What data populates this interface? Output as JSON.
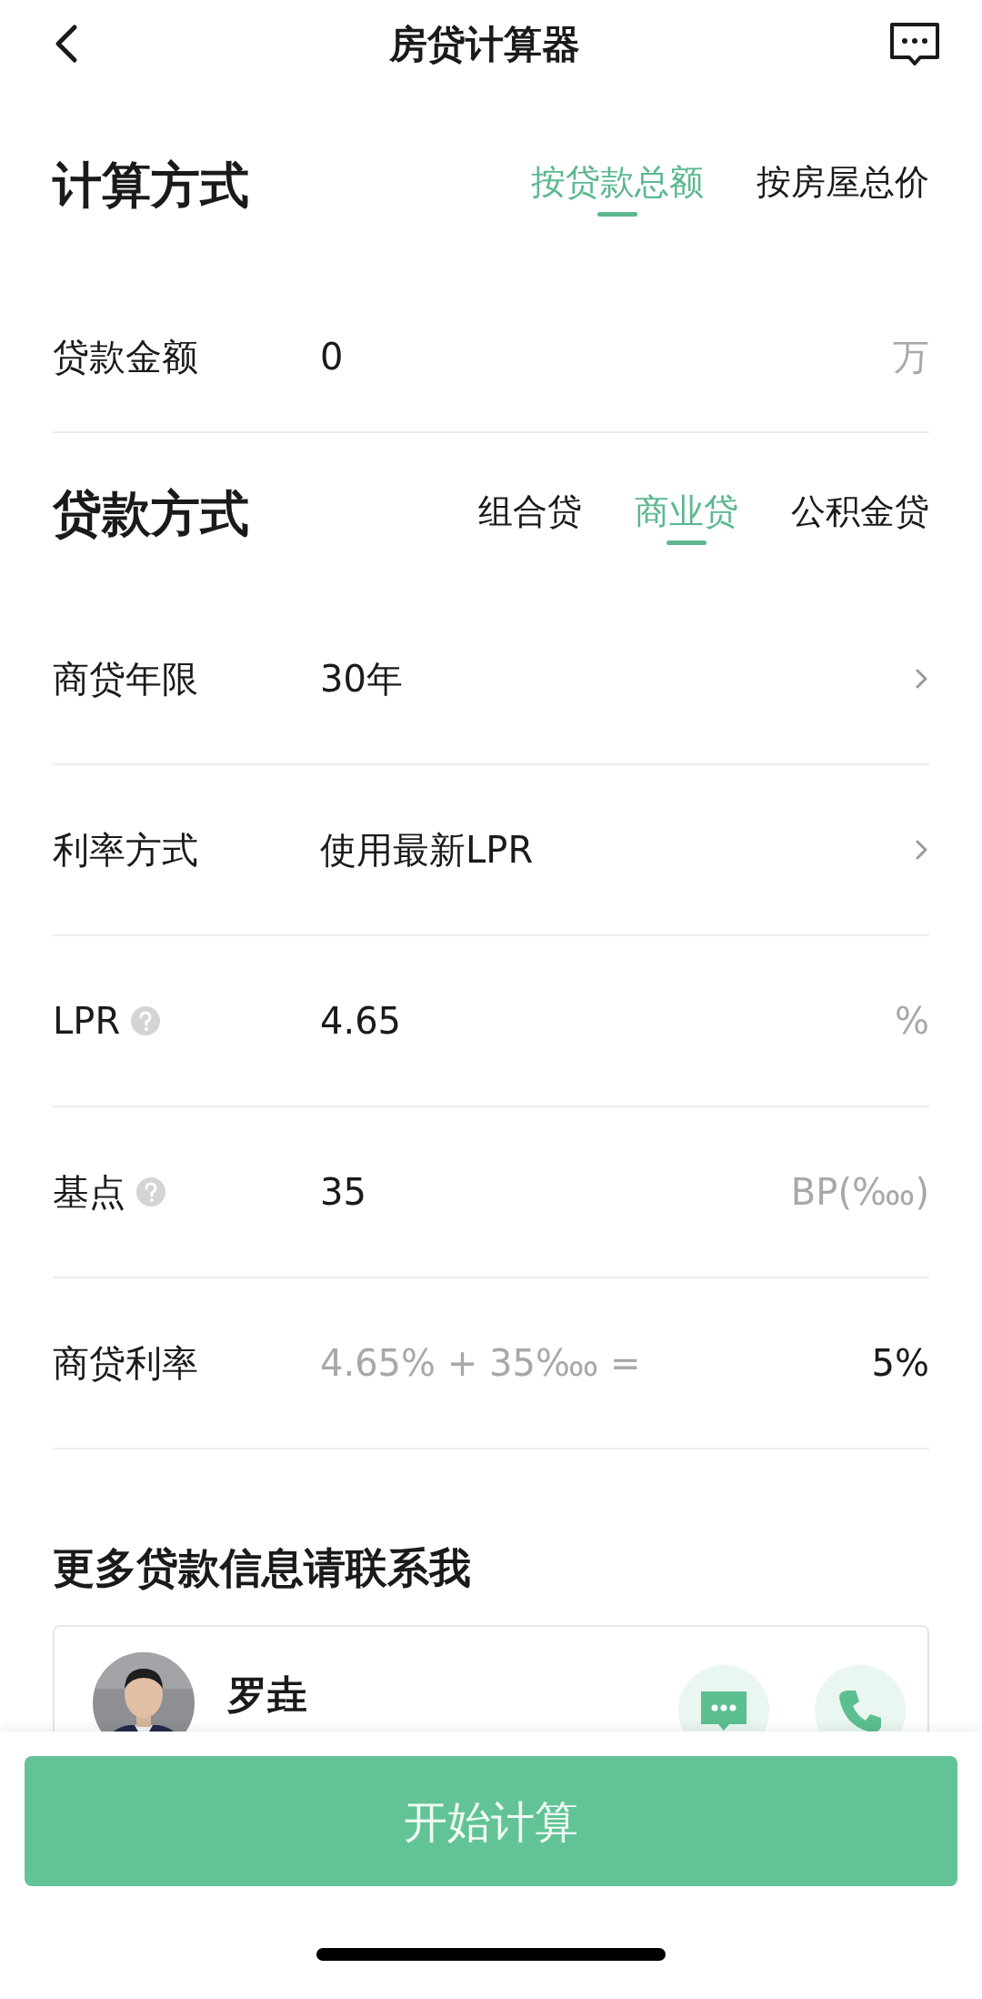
{
  "header": {
    "title": "房贷计算器"
  },
  "calc_method": {
    "title": "计算方式",
    "tabs": [
      {
        "label": "按贷款总额",
        "selected": true
      },
      {
        "label": "按房屋总价",
        "selected": false
      }
    ]
  },
  "loan_amount": {
    "label": "贷款金额",
    "value": "0",
    "unit": "万"
  },
  "loan_type": {
    "title": "贷款方式",
    "tabs": [
      {
        "label": "组合贷",
        "selected": false
      },
      {
        "label": "商业贷",
        "selected": true
      },
      {
        "label": "公积金贷",
        "selected": false
      }
    ]
  },
  "rows": [
    {
      "kind": "select",
      "label": "商贷年限",
      "value": "30年"
    },
    {
      "kind": "select",
      "label": "利率方式",
      "value": "使用最新LPR"
    },
    {
      "kind": "input",
      "label": "LPR",
      "help": true,
      "value": "4.65",
      "unit": "%"
    },
    {
      "kind": "input",
      "label": "基点",
      "help": true,
      "value": "35",
      "unit": "BP(‱)"
    },
    {
      "kind": "result",
      "label": "商贷利率",
      "formula": "4.65% + 35‱ =",
      "value": "5%"
    }
  ],
  "contact": {
    "title": "更多贷款信息请联系我",
    "agent": {
      "name": "罗垚"
    }
  },
  "submit": {
    "label": "开始计算"
  }
}
